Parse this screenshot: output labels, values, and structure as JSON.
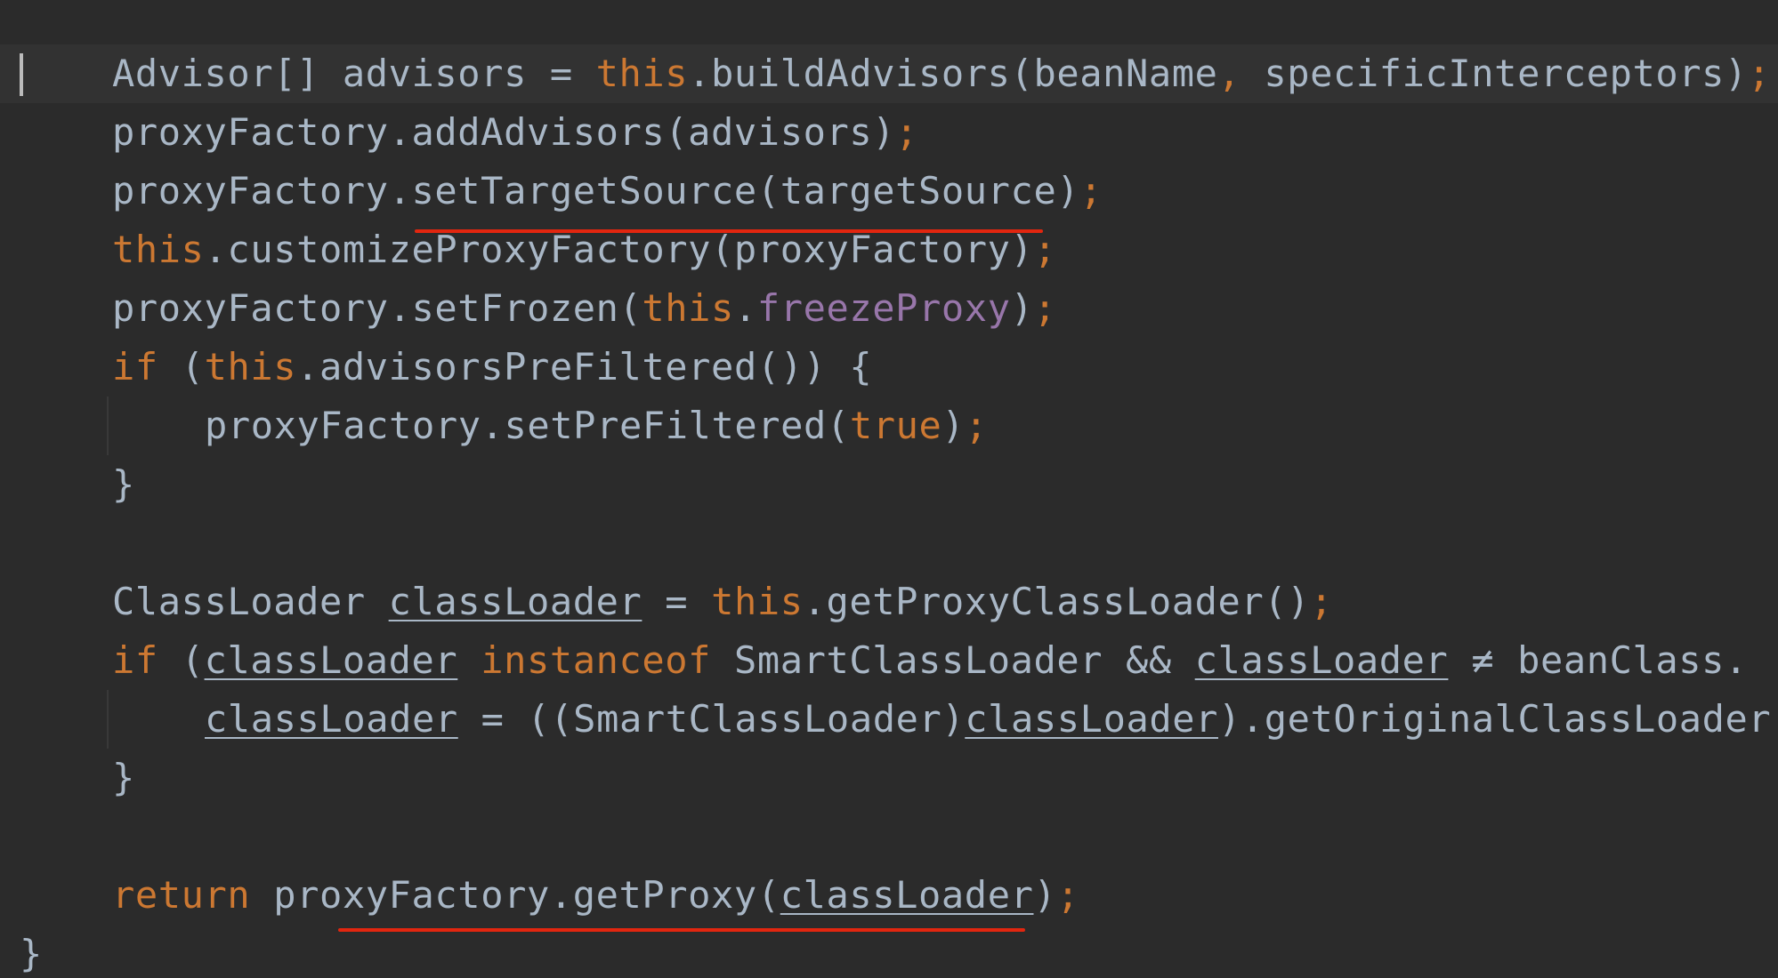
{
  "editor": {
    "lines": {
      "l1": {
        "a": "Advisor[] advisors = ",
        "b": "this",
        "c": ".buildAdvisors(beanName",
        "d": ",",
        "e": " specificInterceptors)",
        "f": ";"
      },
      "l2": {
        "a": "proxyFactory.addAdvisors(advisors)",
        "b": ";"
      },
      "l3": {
        "a": "proxyFactory.setTargetSource(targetSource)",
        "b": ";"
      },
      "l4": {
        "a": "this",
        "b": ".customizeProxyFactory(proxyFactory)",
        "c": ";"
      },
      "l5": {
        "a": "proxyFactory.setFrozen(",
        "b": "this",
        "c": ".",
        "d": "freezeProxy",
        "e": ")",
        "f": ";"
      },
      "l6": {
        "a": "if",
        "b": " (",
        "c": "this",
        "d": ".advisorsPreFiltered()) {"
      },
      "l7": {
        "a": "proxyFactory.setPreFiltered(",
        "b": "true",
        "c": ")",
        "d": ";"
      },
      "l8": {
        "a": "}"
      },
      "l10": {
        "a": "ClassLoader ",
        "b": "classLoader",
        "c": " = ",
        "d": "this",
        "e": ".getProxyClassLoader()",
        "f": ";"
      },
      "l11": {
        "a": "if",
        "b": " (",
        "c": "classLoader",
        "d": " ",
        "e": "instanceof",
        "f": " SmartClassLoader && ",
        "g": "classLoader",
        "h": " ≠ beanClass."
      },
      "l12": {
        "a": "classLoader",
        "b": " = ((SmartClassLoader)",
        "c": "classLoader",
        "d": ").getOriginalClassLoader"
      },
      "l13": {
        "a": "}"
      },
      "l15": {
        "a": "return",
        "b": " proxyFactory.getProxy(",
        "c": "classLoader",
        "d": ")",
        "e": ";"
      },
      "l16": {
        "a": "}"
      }
    }
  },
  "colors": {
    "background": "#2b2b2b",
    "caret_line": "#323232",
    "identifier": "#a9b7c6",
    "keyword": "#cc7832",
    "field": "#9876aa",
    "annotation": "#e2260f"
  }
}
